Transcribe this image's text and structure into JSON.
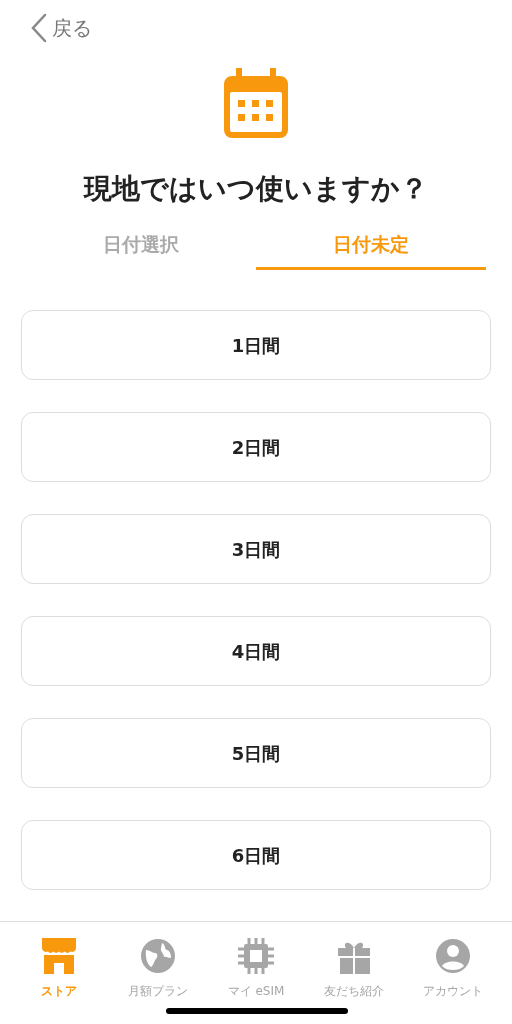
{
  "back": {
    "label": "戻る"
  },
  "title": "現地ではいつ使いますか？",
  "tabs": [
    {
      "label": "日付選択",
      "selected": false
    },
    {
      "label": "日付未定",
      "selected": true
    }
  ],
  "options": [
    "1日間",
    "2日間",
    "3日間",
    "4日間",
    "5日間",
    "6日間"
  ],
  "nav": [
    {
      "kind": "store",
      "label": "ストア",
      "selected": true
    },
    {
      "kind": "globe",
      "label": "月額プラン",
      "selected": false
    },
    {
      "kind": "chip",
      "label": "マイ eSIM",
      "selected": false
    },
    {
      "kind": "gift",
      "label": "友だち紹介",
      "selected": false
    },
    {
      "kind": "account",
      "label": "アカウント",
      "selected": false
    }
  ]
}
